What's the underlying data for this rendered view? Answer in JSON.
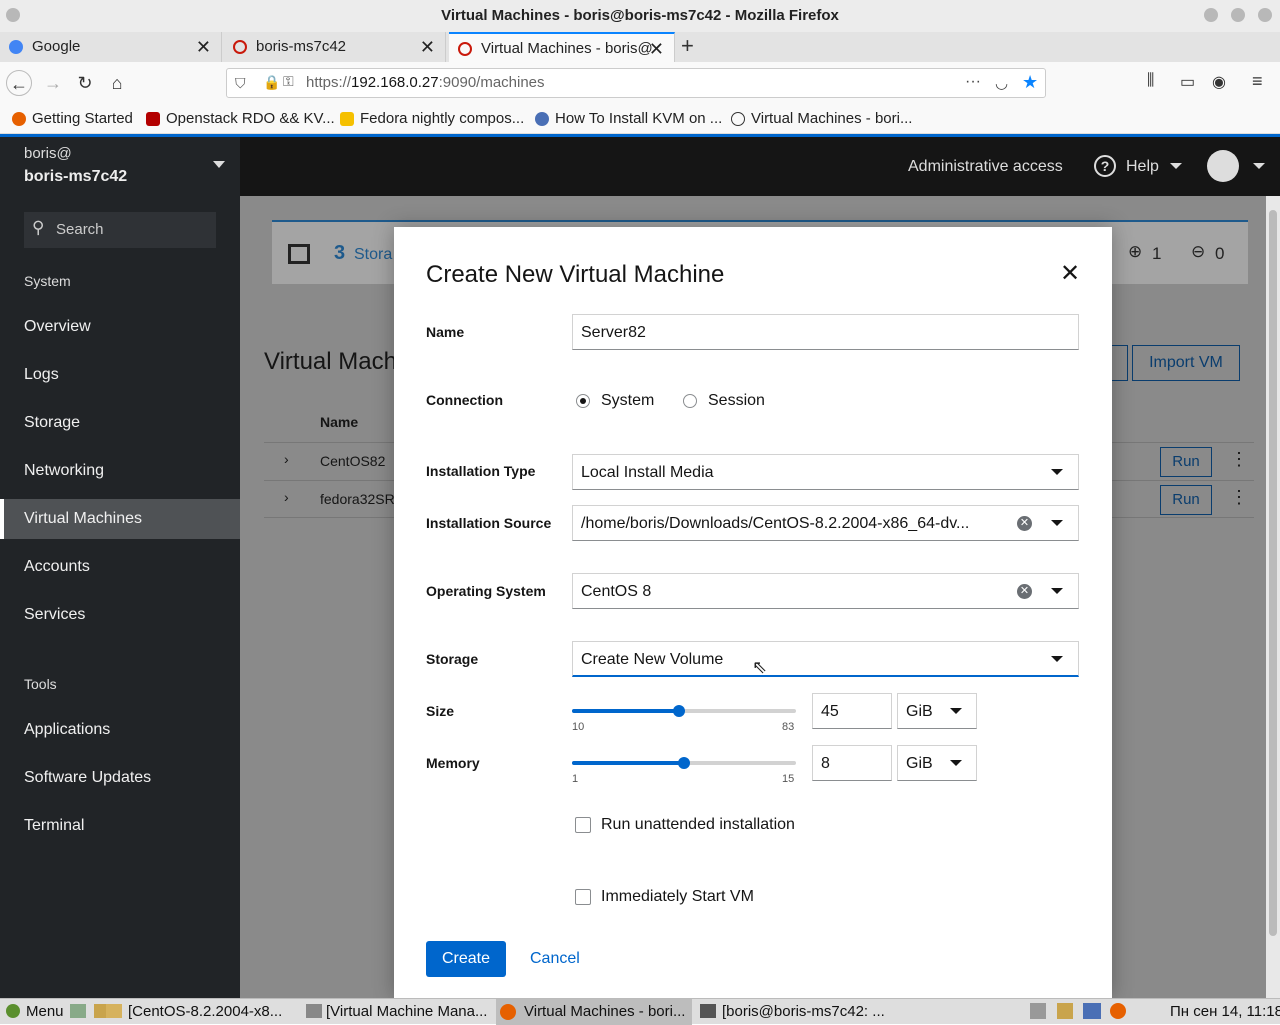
{
  "window": {
    "title": "Virtual Machines - boris@boris-ms7c42 - Mozilla Firefox"
  },
  "tabs": [
    {
      "label": "Google"
    },
    {
      "label": "boris-ms7c42"
    },
    {
      "label": "Virtual Machines - boris@"
    }
  ],
  "url": {
    "prefix": "https://",
    "host": "192.168.0.27",
    "rest": ":9090/machines"
  },
  "bookmarks": [
    {
      "label": "Getting Started"
    },
    {
      "label": "Openstack RDO && KV..."
    },
    {
      "label": "Fedora nightly compos..."
    },
    {
      "label": "How To Install KVM on ..."
    },
    {
      "label": "Virtual Machines - bori..."
    }
  ],
  "sidebar": {
    "user": "boris@",
    "host": "boris-ms7c42",
    "search_placeholder": "Search",
    "section_system": "System",
    "section_tools": "Tools",
    "items": [
      {
        "label": "Overview"
      },
      {
        "label": "Logs"
      },
      {
        "label": "Storage"
      },
      {
        "label": "Networking"
      },
      {
        "label": "Virtual Machines"
      },
      {
        "label": "Accounts"
      },
      {
        "label": "Services"
      },
      {
        "label": "Applications"
      },
      {
        "label": "Software Updates"
      },
      {
        "label": "Terminal"
      }
    ]
  },
  "topbar": {
    "admin": "Administrative access",
    "help": "Help"
  },
  "background": {
    "storage_count": "3",
    "storage_label": "Stora",
    "up_count": "1",
    "down_count": "0",
    "title": "Virtual Mach",
    "import_button": "Import VM",
    "col_name": "Name",
    "rows": [
      {
        "name": "CentOS82"
      },
      {
        "name": "fedora32SR"
      }
    ],
    "run_label": "Run"
  },
  "dialog": {
    "title": "Create New Virtual Machine",
    "name_label": "Name",
    "name_value": "Server82",
    "connection_label": "Connection",
    "conn_system": "System",
    "conn_session": "Session",
    "conn_selected": "System",
    "install_type_label": "Installation Type",
    "install_type_value": "Local Install Media",
    "install_source_label": "Installation Source",
    "install_source_value": "/home/boris/Downloads/CentOS-8.2.2004-x86_64-dv...",
    "os_label": "Operating System",
    "os_value": "CentOS 8",
    "storage_label": "Storage",
    "storage_value": "Create New Volume",
    "size_label": "Size",
    "size_min": "10",
    "size_max": "83",
    "size_value": "45",
    "size_unit": "GiB",
    "memory_label": "Memory",
    "memory_min": "1",
    "memory_max": "15",
    "memory_value": "8",
    "memory_unit": "GiB",
    "unattended_label": "Run unattended installation",
    "start_label": "Immediately Start VM",
    "create_button": "Create",
    "cancel_button": "Cancel"
  },
  "taskbar": {
    "menu": "Menu",
    "items": [
      {
        "label": "[CentOS-8.2.2004-x8..."
      },
      {
        "label": "[Virtual Machine Mana..."
      },
      {
        "label": "Virtual Machines - bori..."
      },
      {
        "label": "[boris@boris-ms7c42: ..."
      }
    ],
    "clock": "Пн сен 14, 11:18"
  },
  "colors": {
    "accent": "#0066cc",
    "sidebar": "#212427",
    "firefox_blue": "#0a84ff"
  }
}
